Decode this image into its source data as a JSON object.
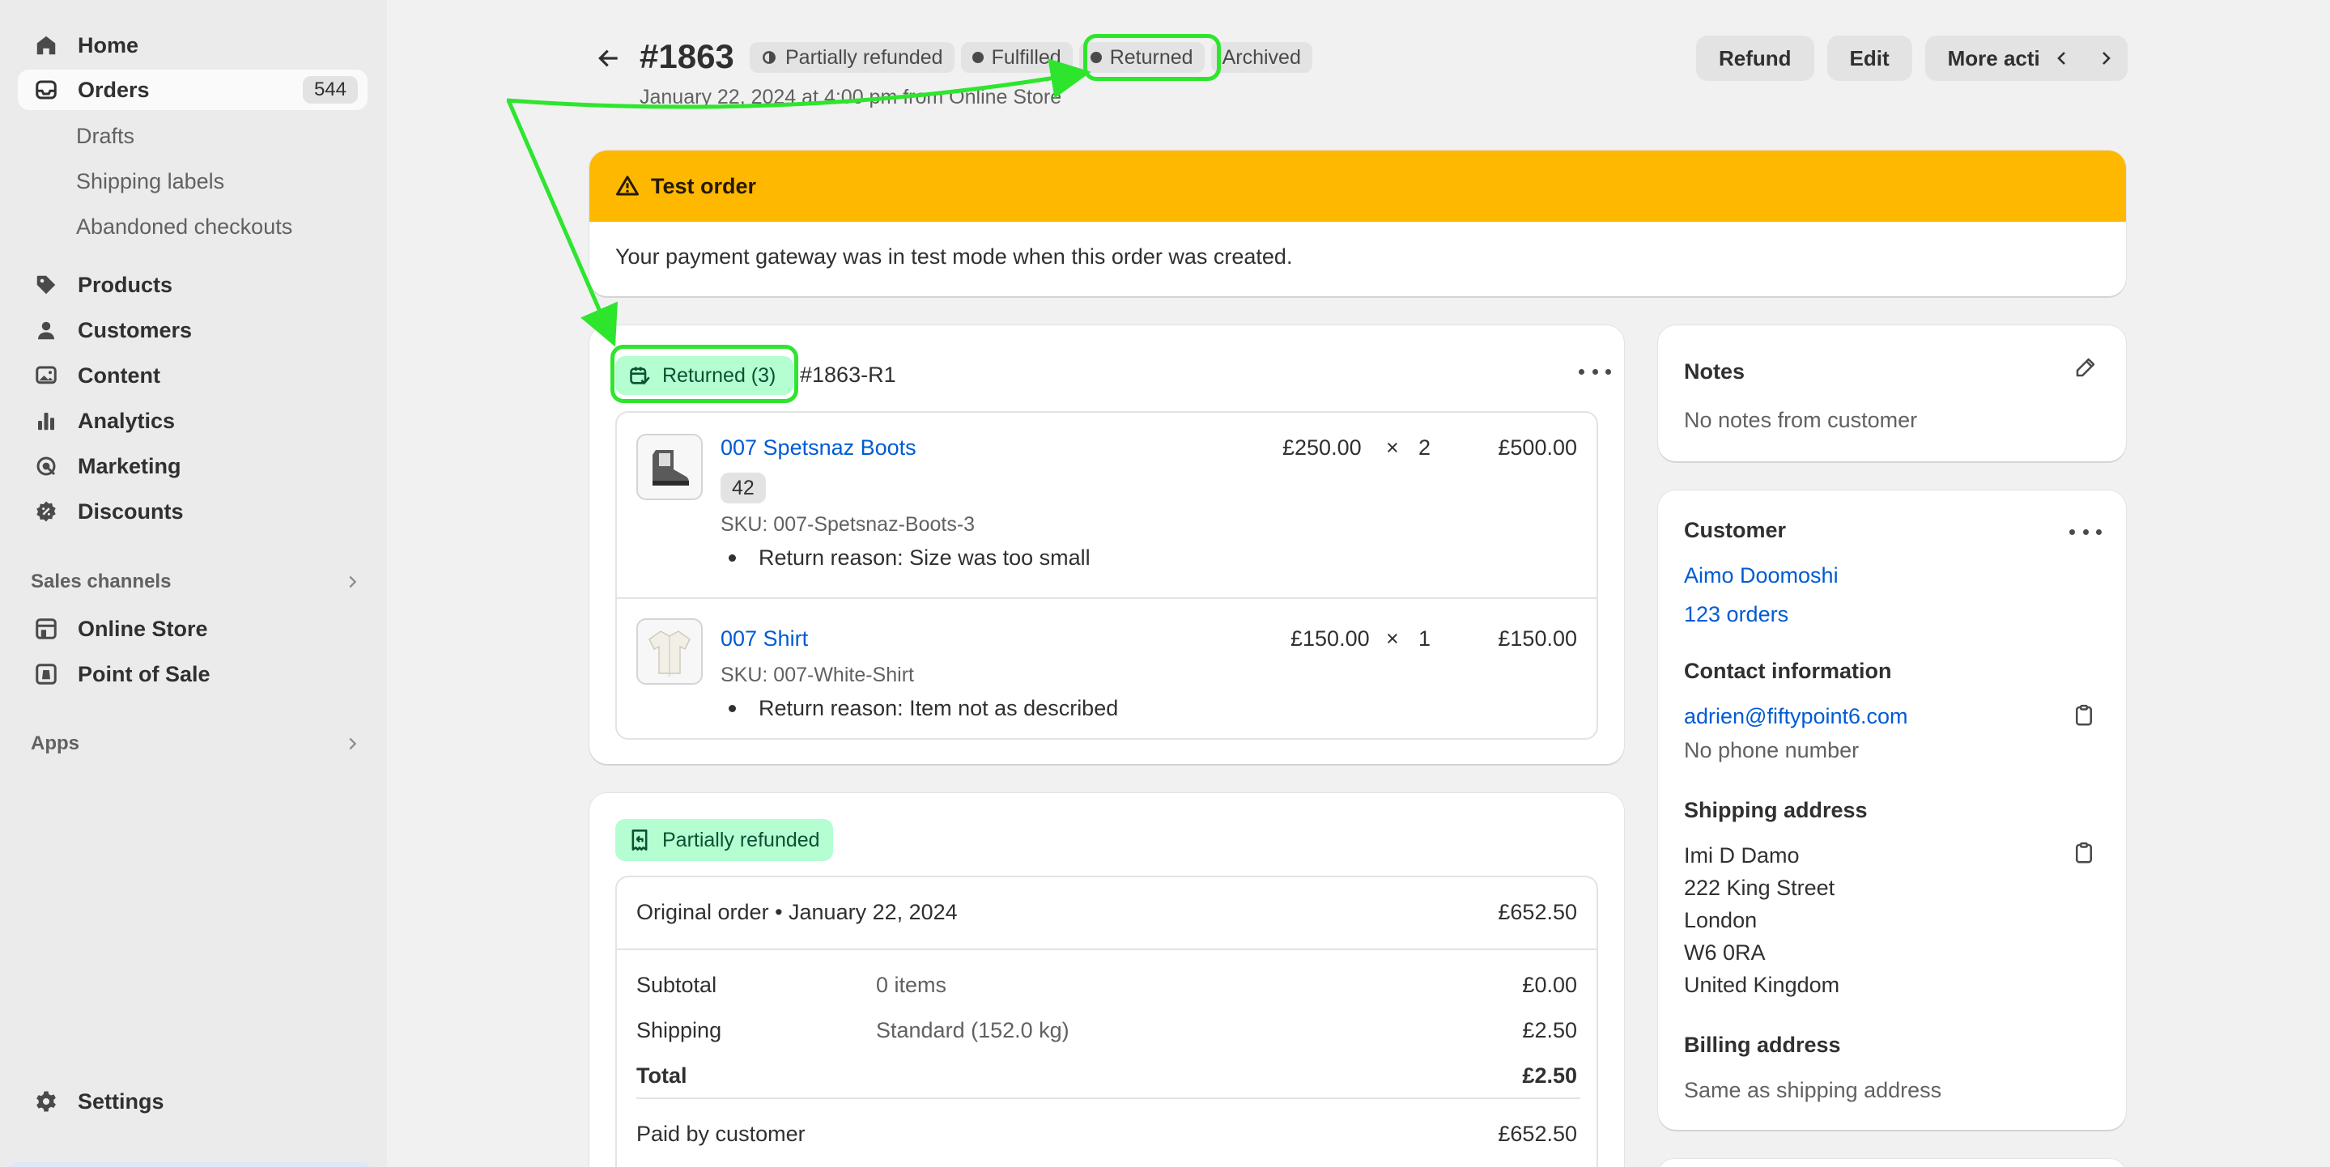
{
  "sidebar": {
    "home": "Home",
    "orders": "Orders",
    "orders_count": "544",
    "drafts": "Drafts",
    "shipping_labels": "Shipping labels",
    "abandoned_checkouts": "Abandoned checkouts",
    "products": "Products",
    "customers": "Customers",
    "content": "Content",
    "analytics": "Analytics",
    "marketing": "Marketing",
    "discounts": "Discounts",
    "sales_channels": "Sales channels",
    "online_store": "Online Store",
    "point_of_sale": "Point of Sale",
    "apps": "Apps",
    "settings": "Settings"
  },
  "header": {
    "order_number": "#1863",
    "badges": [
      "Partially refunded",
      "Fulfilled",
      "Returned",
      "Archived"
    ],
    "subtitle": "January 22, 2024 at 4:00 pm from Online Store",
    "refund": "Refund",
    "edit": "Edit",
    "more_actions": "More actions"
  },
  "warning": {
    "title": "Test order",
    "message": "Your payment gateway was in test mode when this order was created."
  },
  "returned": {
    "badge": "Returned (3)",
    "return_id": "#1863-R1",
    "items": [
      {
        "name": "007 Spetsnaz Boots",
        "variant": "42",
        "sku": "SKU: 007-Spetsnaz-Boots-3",
        "reason": "Return reason: Size was too small",
        "unit_price": "£250.00",
        "times": "×",
        "qty": "2",
        "total": "£500.00"
      },
      {
        "name": "007 Shirt",
        "sku": "SKU: 007-White-Shirt",
        "reason": "Return reason: Item not as described",
        "unit_price": "£150.00",
        "times": "×",
        "qty": "1",
        "total": "£150.00"
      }
    ]
  },
  "refund": {
    "badge": "Partially refunded",
    "original_order": "Original order • January 22, 2024",
    "original_total": "£652.50",
    "subtotal_label": "Subtotal",
    "subtotal_items": "0 items",
    "subtotal_value": "£0.00",
    "shipping_label": "Shipping",
    "shipping_method": "Standard (152.0 kg)",
    "shipping_value": "£2.50",
    "total_label": "Total",
    "total_value": "£2.50",
    "paid_label": "Paid by customer",
    "paid_value": "£652.50"
  },
  "notes": {
    "title": "Notes",
    "text": "No notes from customer"
  },
  "customer": {
    "title": "Customer",
    "name": "Aimo Doomoshi",
    "orders": "123 orders",
    "contact_title": "Contact information",
    "email": "adrien@fiftypoint6.com",
    "phone": "No phone number",
    "shipping_title": "Shipping address",
    "address": [
      "Imi D Damo",
      "222 King Street",
      "London",
      "W6 0RA",
      "United Kingdom"
    ],
    "billing_title": "Billing address",
    "billing_text": "Same as shipping address"
  },
  "colors": {
    "warning": "#ffb800",
    "success_badge": "#b4fed2",
    "link": "#005bd3",
    "annotation": "#2ee52e"
  }
}
